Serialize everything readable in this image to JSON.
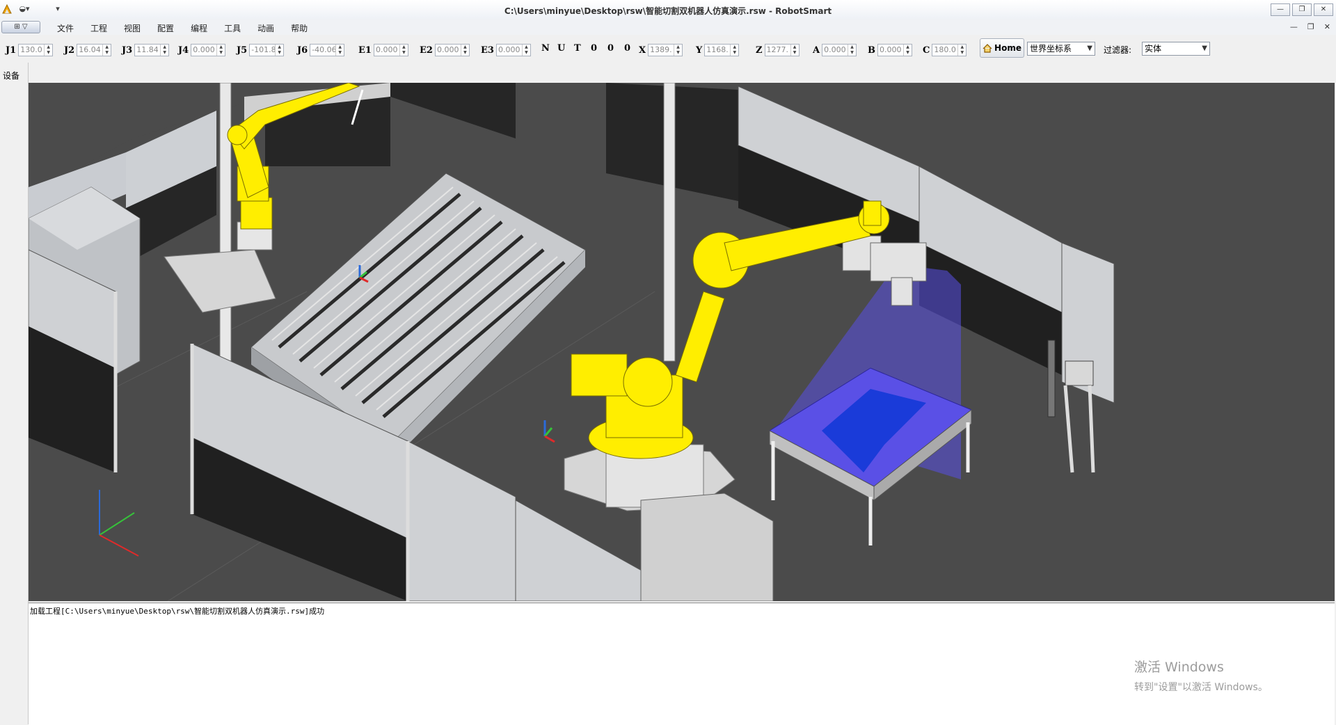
{
  "window": {
    "title": "C:\\Users\\minyue\\Desktop\\rsw\\智能切割双机器人仿真演示.rsw - RobotSmart",
    "controls": [
      "—",
      "❐",
      "✕"
    ]
  },
  "menubar": {
    "app_button": "⊞ ▽",
    "items": [
      "文件",
      "工程",
      "视图",
      "配置",
      "编程",
      "工具",
      "动画",
      "帮助"
    ],
    "mdi_controls": [
      "—",
      "❐",
      "✕"
    ]
  },
  "toolbar": {
    "joints": [
      {
        "label": "J1",
        "value": "130.0"
      },
      {
        "label": "J2",
        "value": "16.04"
      },
      {
        "label": "J3",
        "value": "11.84"
      },
      {
        "label": "J4",
        "value": "0.000"
      },
      {
        "label": "J5",
        "value": "-101.8"
      },
      {
        "label": "J6",
        "value": "-40.06"
      },
      {
        "label": "E1",
        "value": "0.000"
      },
      {
        "label": "E2",
        "value": "0.000"
      },
      {
        "label": "E3",
        "value": "0.000"
      }
    ],
    "config_letters": [
      "N",
      "U",
      "T",
      "0",
      "0",
      "0"
    ],
    "cartesian": [
      {
        "label": "X",
        "value": "1389."
      },
      {
        "label": "Y",
        "value": "1168."
      },
      {
        "label": "Z",
        "value": "1277."
      },
      {
        "label": "A",
        "value": "0.000"
      },
      {
        "label": "B",
        "value": "0.000"
      },
      {
        "label": "C",
        "value": "180.0"
      }
    ],
    "home_label": "Home",
    "coord_system": "世界坐标系",
    "filter_label": "过滤器:",
    "filter_value": "实体"
  },
  "side_panel": {
    "tab": "设备"
  },
  "console": {
    "message": "加载工程[C:\\Users\\minyue\\Desktop\\rsw\\智能切割双机器人仿真演示.rsw]成功"
  },
  "watermark": {
    "line1": "激活 Windows",
    "line2": "转到\"设置\"以激活 Windows。"
  },
  "colors": {
    "robot_yellow": "#ffee00",
    "viewport_bg": "#4b4b4b",
    "scan_blue": "#5a50e6"
  },
  "icons": {
    "home": "home-icon",
    "app": "robotsmart-logo-icon"
  }
}
